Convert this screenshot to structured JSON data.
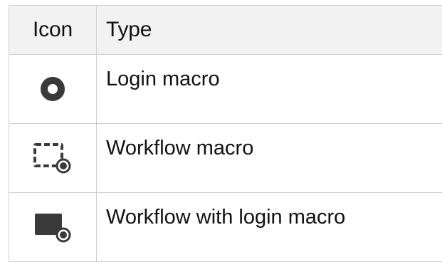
{
  "table": {
    "headers": {
      "icon": "Icon",
      "type": "Type"
    },
    "rows": [
      {
        "icon": "login-macro-icon",
        "type": "Login macro"
      },
      {
        "icon": "workflow-macro-icon",
        "type": "Workflow macro"
      },
      {
        "icon": "workflow-with-login-macro-icon",
        "type": "Workflow with login macro"
      }
    ]
  },
  "colors": {
    "icon_fill": "#3a3a3a",
    "header_bg": "#f2f2f2",
    "border": "#cfcfcf"
  }
}
